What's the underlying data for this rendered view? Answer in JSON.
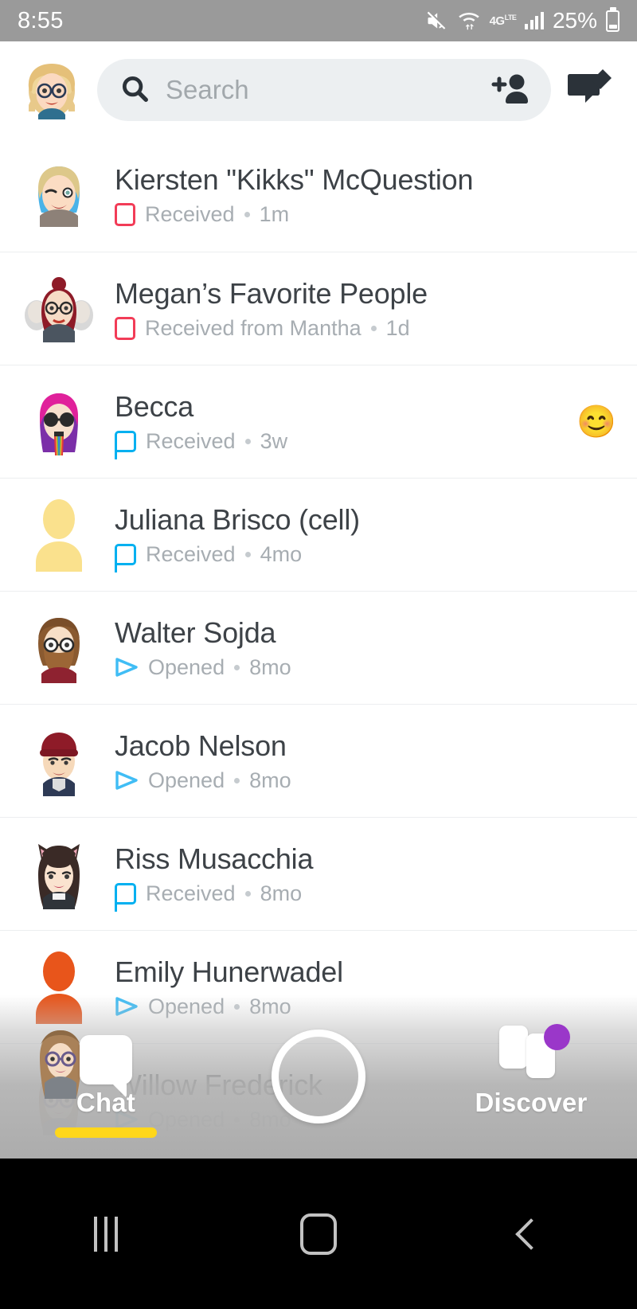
{
  "status_bar": {
    "time": "8:55",
    "battery_percent": "25%",
    "network_type": "4G",
    "icons": [
      "mute-icon",
      "wifi-icon",
      "lte-icon",
      "signal-bars-icon",
      "battery-icon"
    ]
  },
  "header": {
    "profile_avatar": "profile-bitmoji-avatar",
    "search_placeholder": "Search",
    "search_value": "",
    "add_friend_icon": "add-friend-icon",
    "new_chat_icon": "new-chat-icon"
  },
  "chats": [
    {
      "name": "Kiersten \"Kikks\" McQuestion",
      "status": "Received",
      "time": "1m",
      "status_type": "snap-unopened",
      "avatar": "bitmoji-blonde-blue-hair",
      "emoji": ""
    },
    {
      "name": "Megan’s Favorite People",
      "status": "Received from Mantha",
      "time": "1d",
      "status_type": "snap-unopened",
      "avatar": "bitmoji-group-red-hair",
      "emoji": ""
    },
    {
      "name": "Becca",
      "status": "Received",
      "time": "3w",
      "status_type": "chat-unopened",
      "avatar": "bitmoji-pink-hair-rainbow",
      "emoji": "😊"
    },
    {
      "name": "Juliana Brisco (cell)",
      "status": "Received",
      "time": "4mo",
      "status_type": "chat-unopened",
      "avatar": "silhouette-yellow",
      "emoji": ""
    },
    {
      "name": "Walter Sojda",
      "status": "Opened",
      "time": "8mo",
      "status_type": "opened",
      "avatar": "bitmoji-bearded-glasses",
      "emoji": ""
    },
    {
      "name": "Jacob Nelson",
      "status": "Opened",
      "time": "8mo",
      "status_type": "opened",
      "avatar": "bitmoji-red-beanie",
      "emoji": ""
    },
    {
      "name": "Riss Musacchia",
      "status": "Received",
      "time": "8mo",
      "status_type": "chat-unopened",
      "avatar": "bitmoji-cat-ears",
      "emoji": ""
    },
    {
      "name": "Emily Hunerwadel",
      "status": "Opened",
      "time": "8mo",
      "status_type": "opened",
      "avatar": "silhouette-orange",
      "emoji": ""
    },
    {
      "name": "Willow Frederick",
      "status": "Opened",
      "time": "8mo",
      "status_type": "opened",
      "avatar": "bitmoji-glasses-brown-hair",
      "emoji": ""
    }
  ],
  "bottom_nav": {
    "chat_label": "Chat",
    "discover_label": "Discover",
    "camera_button": "camera-capture-button",
    "active_tab": "Chat",
    "discover_badge": true
  },
  "android_nav": {
    "recents": "recents-button",
    "home": "home-button",
    "back": "back-button"
  },
  "colors": {
    "snap_unopened": "#f23c57",
    "chat_unopened": "#00b0f0",
    "opened": "#40bdf5",
    "accent_yellow": "#ffd71a",
    "badge_purple": "#9a37c9",
    "status_bar": "#9a9a9a"
  }
}
